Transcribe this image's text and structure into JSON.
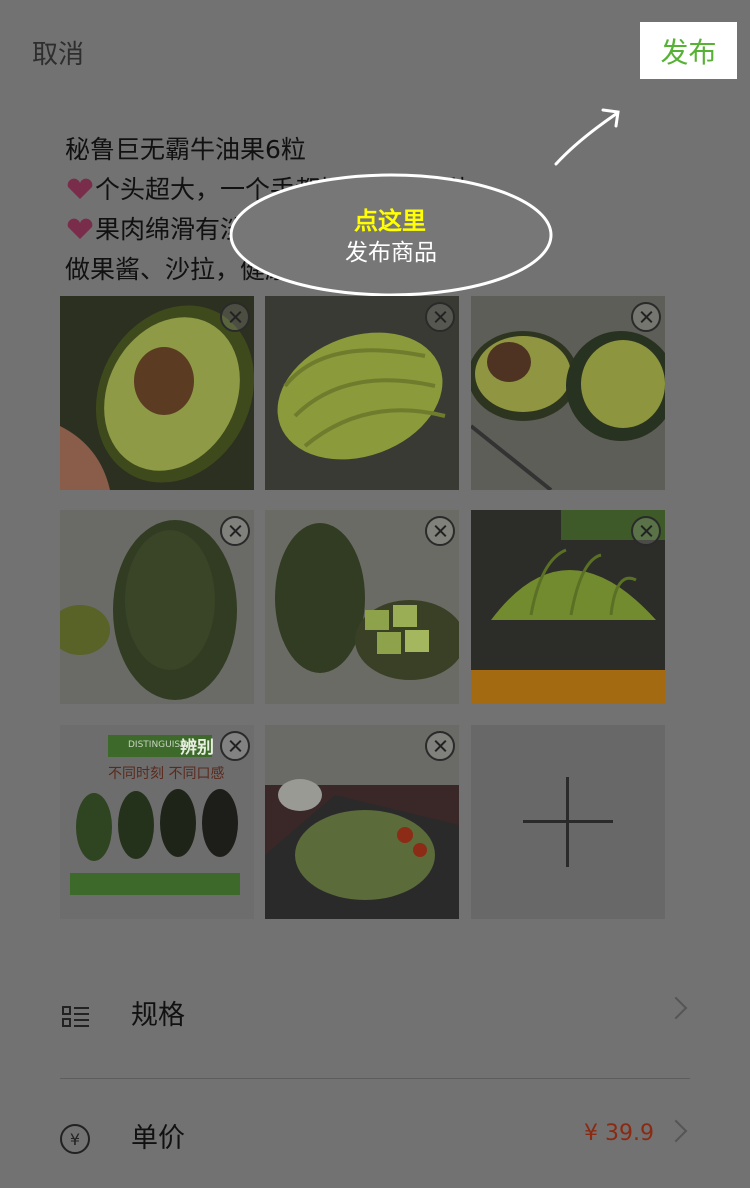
{
  "header": {
    "cancel_label": "取消",
    "publish_label": "发布"
  },
  "description": {
    "line1": "秘鲁巨无霸牛油果6粒",
    "line2": "个头超大，一个手都握不住的那种",
    "line3": "果肉绵滑有淡淡的奶油香",
    "line4": "做果酱、沙拉，健康好吃赢美味"
  },
  "tooltip": {
    "title": "点这里",
    "subtitle": "发布商品"
  },
  "photos": [
    "avatar-photo",
    "avocado-photo",
    "avocado-photo",
    "avocado-photo",
    "avocado-photo",
    "avocado-photo",
    "distinguish-photo",
    "salad-photo"
  ],
  "distinguish_card": {
    "title": "辨别",
    "eng": "DISTINGUISH",
    "subtitle": "不同时刻 不同口感"
  },
  "options": [
    {
      "label": "规格",
      "value": ""
    },
    {
      "label": "单价",
      "value": "¥ 39.9"
    }
  ],
  "colors": {
    "accent_green": "#56b234",
    "price_red": "#c0391b",
    "tooltip_yellow": "#ffff00"
  }
}
